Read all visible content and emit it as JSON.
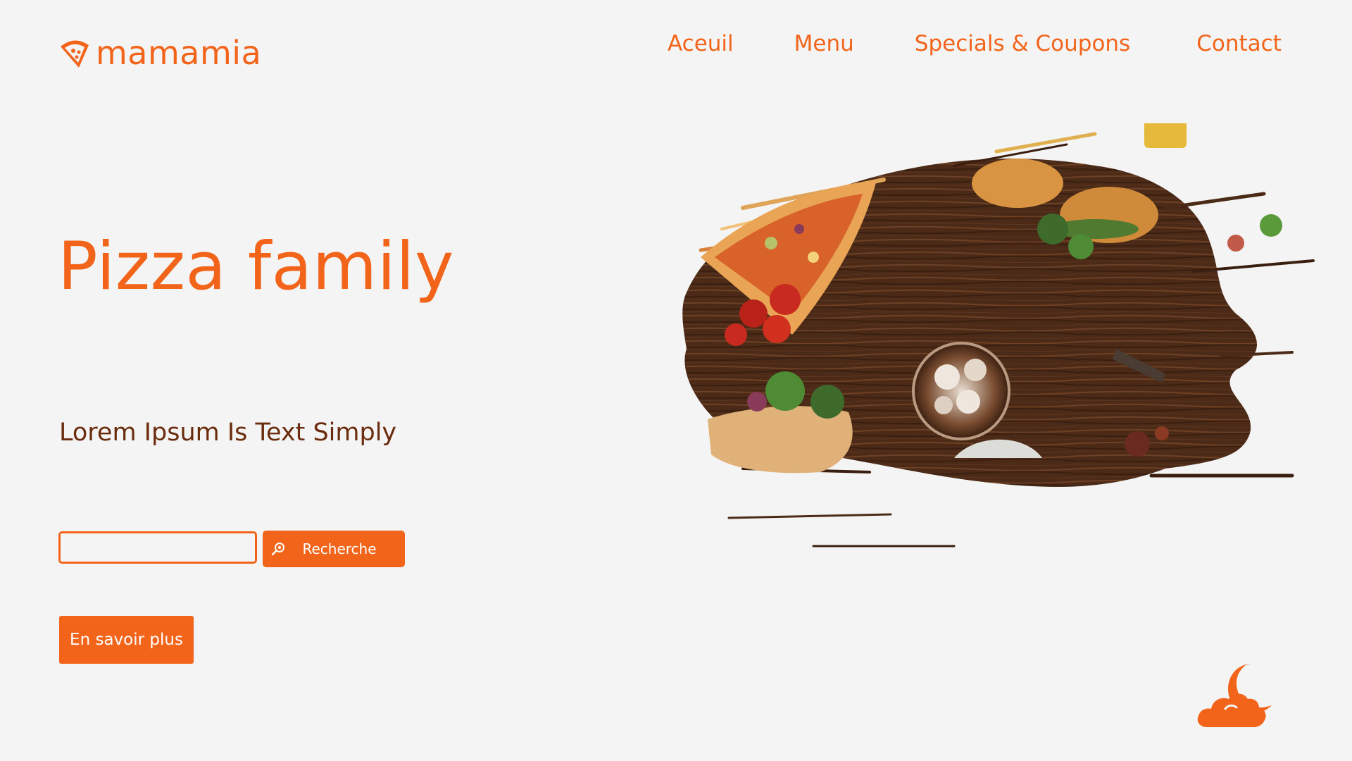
{
  "brand": {
    "name": "mamamia",
    "icon": "pizza-slice-icon",
    "color": "#f26419"
  },
  "nav": {
    "items": [
      {
        "label": "Aceuil"
      },
      {
        "label": "Menu"
      },
      {
        "label": "Specials & Coupons"
      },
      {
        "label": "Contact"
      }
    ]
  },
  "hero": {
    "title": "Pizza family",
    "subtitle": "Lorem Ipsum Is Text Simply",
    "image": "food-on-wooden-table-brush-stroke"
  },
  "search": {
    "value": "",
    "placeholder": "",
    "button_label": "Recherche",
    "icon": "search-icon"
  },
  "cta": {
    "label": "En savoir plus"
  },
  "theme_toggle": {
    "icon": "moon-cloud-icon"
  },
  "colors": {
    "accent": "#f26419",
    "subtitle": "#6b2c0e",
    "background": "#f4f4f4"
  }
}
